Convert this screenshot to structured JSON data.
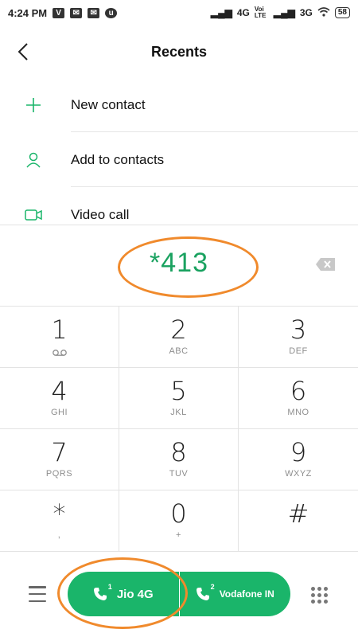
{
  "status_bar": {
    "time": "4:24 PM",
    "left_icons": [
      "v-app-icon",
      "mail-icon",
      "mail-icon",
      "app-icon"
    ],
    "right": {
      "network1": "4G",
      "volte": "Voi LTE",
      "network2": "3G",
      "battery": "58"
    }
  },
  "header": {
    "title": "Recents"
  },
  "menu": {
    "items": [
      {
        "label": "New contact",
        "icon": "plus-icon"
      },
      {
        "label": "Add to contacts",
        "icon": "person-icon"
      },
      {
        "label": "Video call",
        "icon": "video-camera-icon"
      }
    ]
  },
  "dial": {
    "number": "*413"
  },
  "keypad": {
    "keys": [
      {
        "digit": "1",
        "letters": ""
      },
      {
        "digit": "2",
        "letters": "ABC"
      },
      {
        "digit": "3",
        "letters": "DEF"
      },
      {
        "digit": "4",
        "letters": "GHI"
      },
      {
        "digit": "5",
        "letters": "JKL"
      },
      {
        "digit": "6",
        "letters": "MNO"
      },
      {
        "digit": "7",
        "letters": "PQRS"
      },
      {
        "digit": "8",
        "letters": "TUV"
      },
      {
        "digit": "9",
        "letters": "WXYZ"
      },
      {
        "digit": "*",
        "letters": ","
      },
      {
        "digit": "0",
        "letters": "+"
      },
      {
        "digit": "#",
        "letters": ""
      }
    ]
  },
  "call": {
    "sim1": {
      "label": "Jio 4G",
      "slot": "1"
    },
    "sim2": {
      "label": "Vodafone IN",
      "slot": "2"
    }
  },
  "colors": {
    "accent": "#1ab56a",
    "highlight": "#f08a2c"
  }
}
